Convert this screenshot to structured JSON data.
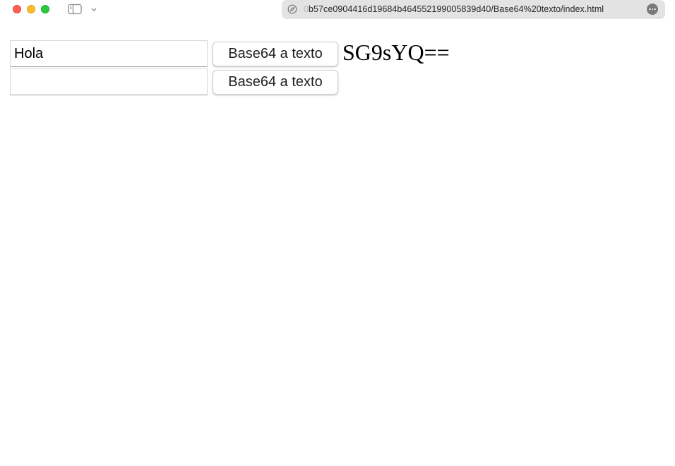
{
  "browser": {
    "url_faded_prefix": "0",
    "url_text": "b57ce0904416d19684b464552199005839d40/Base64%20texto/index.html",
    "icons": [
      "close-window",
      "minimize-window",
      "maximize-window",
      "sidebar-icon",
      "chevron-down-icon",
      "compass-icon",
      "more-icon"
    ]
  },
  "form": {
    "input1_value": "Hola",
    "input2_value": "",
    "button1_label": "Base64 a texto",
    "button2_label": "Base64 a texto",
    "result_text": "SG9sYQ=="
  }
}
